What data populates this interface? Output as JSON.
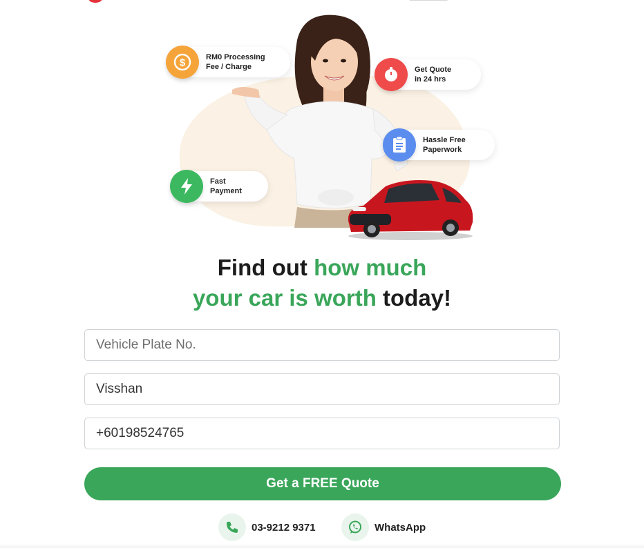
{
  "hero": {
    "badges": [
      {
        "label": "RM0 Processing\nFee / Charge",
        "icon": "dollar-icon",
        "color": "#f5a43a"
      },
      {
        "label": "Get Quote\nin 24 hrs",
        "icon": "stopwatch-icon",
        "color": "#ef4b4b"
      },
      {
        "label": "Hassle Free\nPaperwork",
        "icon": "document-icon",
        "color": "#5b8def"
      },
      {
        "label": "Fast\nPayment",
        "icon": "lightning-icon",
        "color": "#3cb960"
      }
    ]
  },
  "headline": {
    "part1": "Find out ",
    "part2": "how much",
    "part3": "your car is worth",
    "part4": " today!"
  },
  "form": {
    "plate_placeholder": "Vehicle Plate No.",
    "plate_value": "",
    "name_value": "Visshan",
    "phone_value": "+60198524765",
    "submit_label": "Get a FREE Quote"
  },
  "contact": {
    "phone": "03-9212 9371",
    "whatsapp": "WhatsApp"
  },
  "colors": {
    "brand_green": "#3aa65a",
    "headline_dark": "#1c1c1c"
  }
}
